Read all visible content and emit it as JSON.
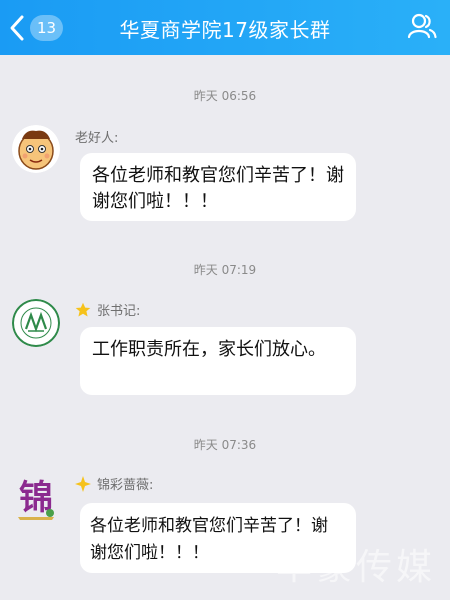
{
  "header": {
    "back_badge": "13",
    "title": "华夏商学院17级家长群"
  },
  "messages": [
    {
      "time": "昨天 06:56",
      "sender": "老好人:",
      "text": "各位老师和教官您们辛苦了！谢谢您们啦！！！"
    },
    {
      "time": "昨天 07:19",
      "sender": "张书记:",
      "text": "工作职责所在，家长们放心。"
    },
    {
      "time": "昨天 07:36",
      "sender": "锦彩蔷薇:",
      "text": "各位老师和教官您们辛苦了！谢谢您们啦！！！"
    }
  ],
  "avatar3_char": "锦",
  "watermark": "华豪传媒",
  "colors": {
    "header": "#1a9bf4",
    "chat_bg": "#ebebf0",
    "bubble": "#ffffff",
    "star": "#f6c21b"
  }
}
